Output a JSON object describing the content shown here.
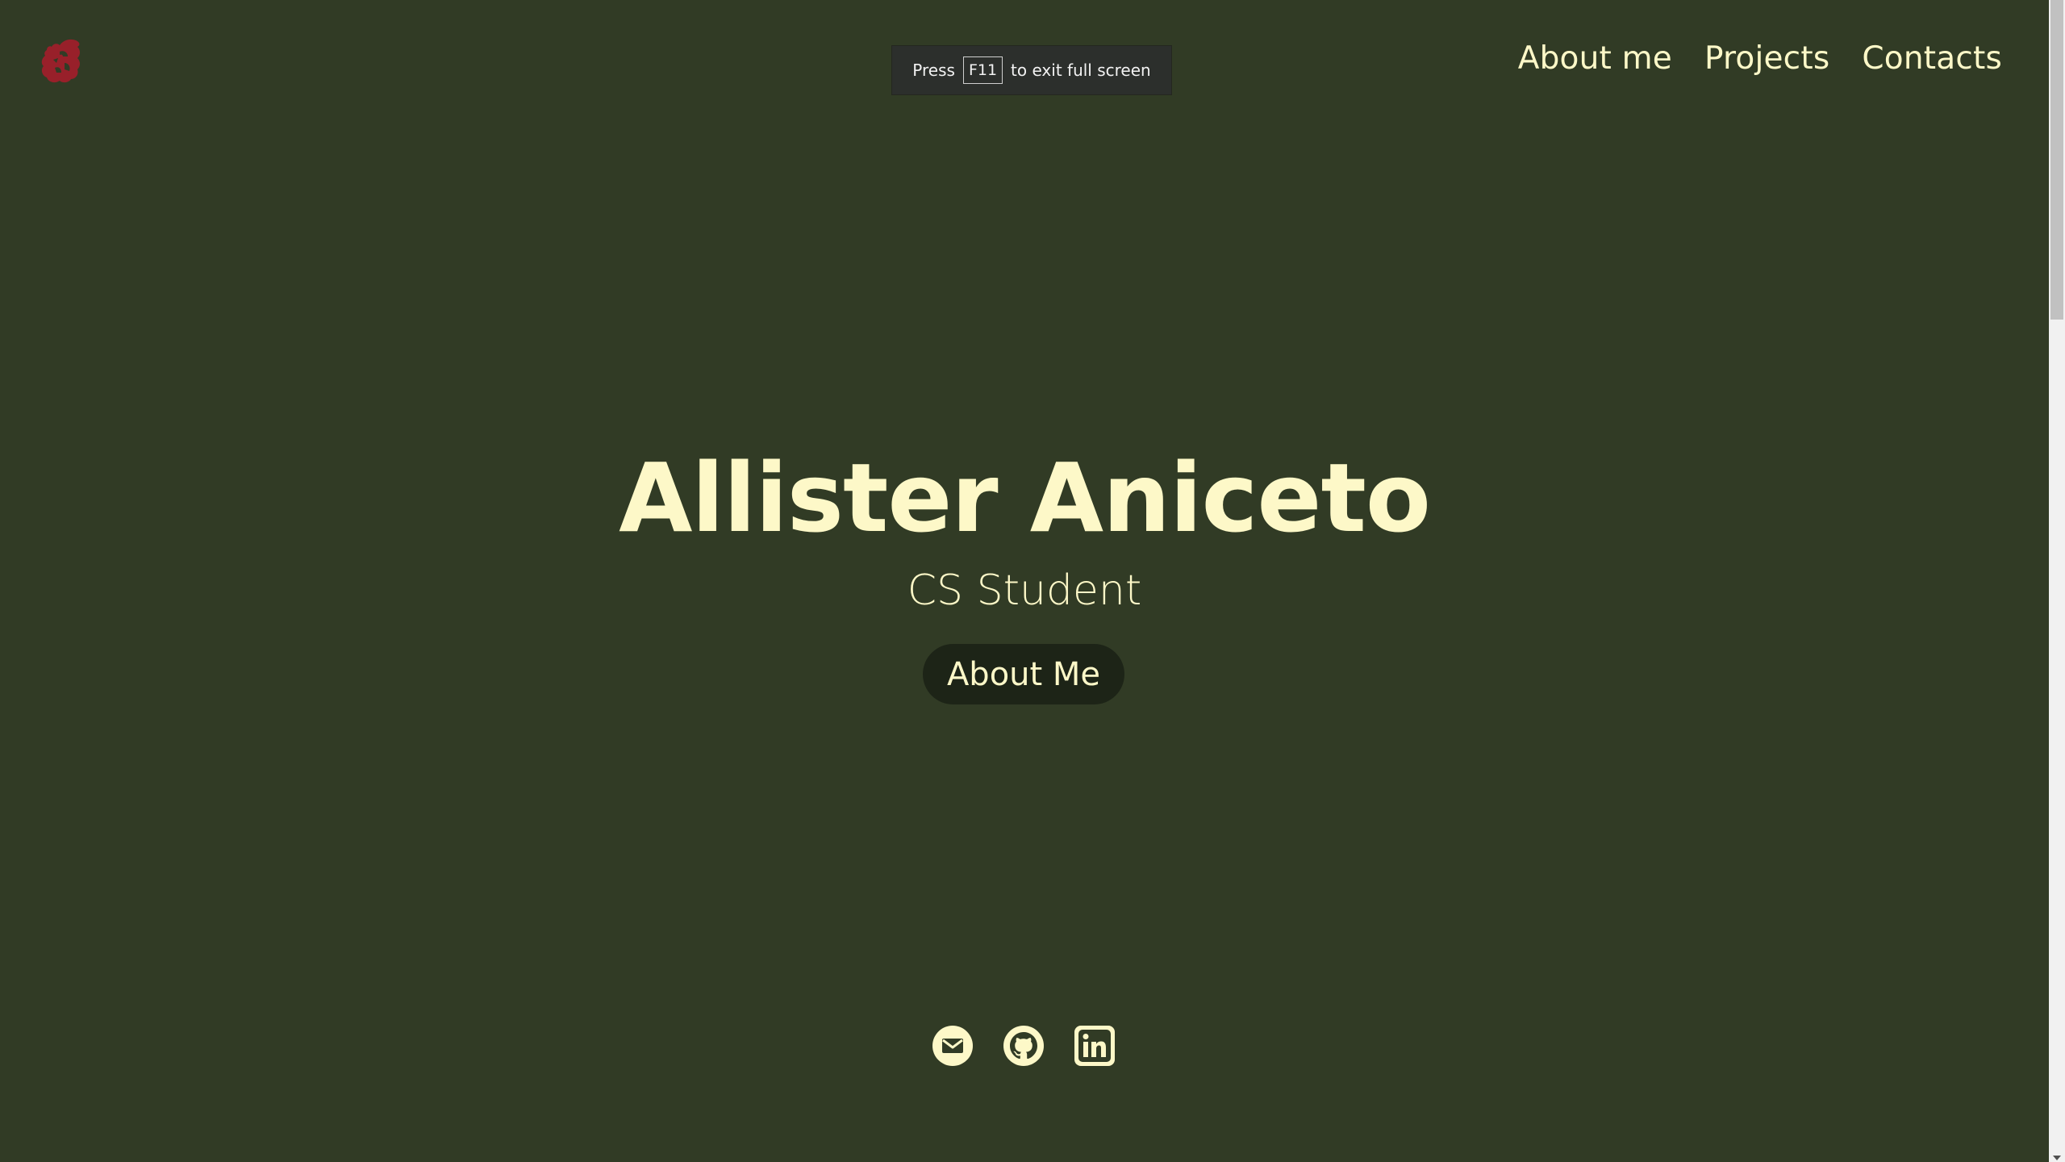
{
  "nav": {
    "items": [
      {
        "label": "About me"
      },
      {
        "label": "Projects"
      },
      {
        "label": "Contacts"
      }
    ]
  },
  "fullscreen_notice": {
    "prefix": "Press",
    "key": "F11",
    "suffix": "to exit full screen"
  },
  "hero": {
    "name": "Allister Aniceto",
    "role": "CS Student",
    "button_label": "About Me"
  },
  "socials": [
    {
      "icon": "email-icon"
    },
    {
      "icon": "github-icon"
    },
    {
      "icon": "linkedin-icon"
    }
  ],
  "colors": {
    "background": "#313b25",
    "text": "#fdf8c8",
    "button_bg": "#1d2417",
    "logo": "#98202a"
  }
}
